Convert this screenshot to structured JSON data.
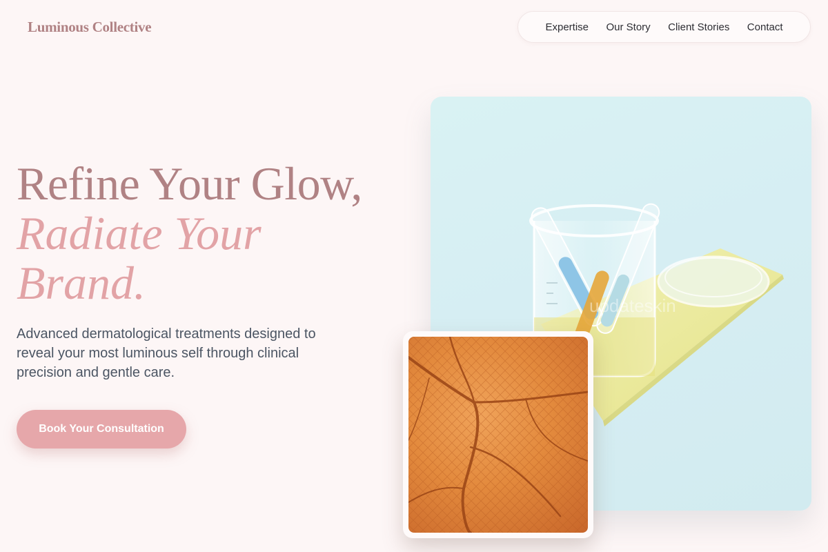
{
  "brand": {
    "name": "Luminous Collective"
  },
  "nav": {
    "items": [
      {
        "label": "Expertise"
      },
      {
        "label": "Our Story"
      },
      {
        "label": "Client Stories"
      },
      {
        "label": "Contact"
      }
    ]
  },
  "hero": {
    "headline_line1": "Refine Your Glow,",
    "headline_line2": "Radiate Your",
    "headline_line3": "Brand.",
    "subtitle": "Advanced dermatological treatments designed to reveal your most luminous self through clinical precision and gentle care.",
    "cta_label": "Book Your Consultation"
  },
  "images": {
    "main_image_watermark": "updateskin"
  },
  "colors": {
    "background": "#fdf6f6",
    "brand_mauve": "#b08284",
    "accent_pink": "#e6a7aa",
    "body_text": "#4b5563"
  }
}
